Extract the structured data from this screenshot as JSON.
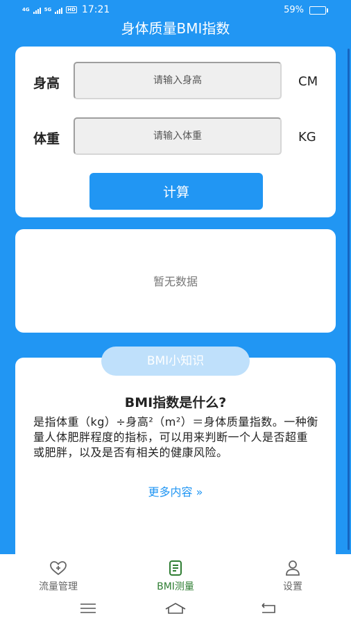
{
  "status_bar": {
    "network_1": "4G",
    "network_2": "5G",
    "hd_badge": "HD",
    "time": "17:21",
    "battery_percent": "59%",
    "battery_level": 0.59
  },
  "header": {
    "title": "身体质量BMI指数"
  },
  "form": {
    "height": {
      "label": "身高",
      "placeholder": "请输入身高",
      "value": "",
      "unit": "CM"
    },
    "weight": {
      "label": "体重",
      "placeholder": "请输入体重",
      "value": "",
      "unit": "KG"
    },
    "calculate_label": "计算"
  },
  "result": {
    "empty_text": "暂无数据"
  },
  "knowledge": {
    "badge": "BMI小知识",
    "title": "BMI指数是什么?",
    "body": "是指体重（kg）÷身高²（m²）＝身体质量指数。一种衡量人体肥胖程度的指标，可以用来判断一个人是否超重或肥胖，以及是否有相关的健康风险。",
    "more": "更多内容 »"
  },
  "tabs": [
    {
      "label": "流量管理",
      "icon": "heart-plus-icon",
      "active": false
    },
    {
      "label": "BMI测量",
      "icon": "document-icon",
      "active": true
    },
    {
      "label": "设置",
      "icon": "person-icon",
      "active": false
    }
  ],
  "colors": {
    "primary": "#2196F3",
    "active_tab": "#2e7d32",
    "pill": "#bfe0fb"
  }
}
